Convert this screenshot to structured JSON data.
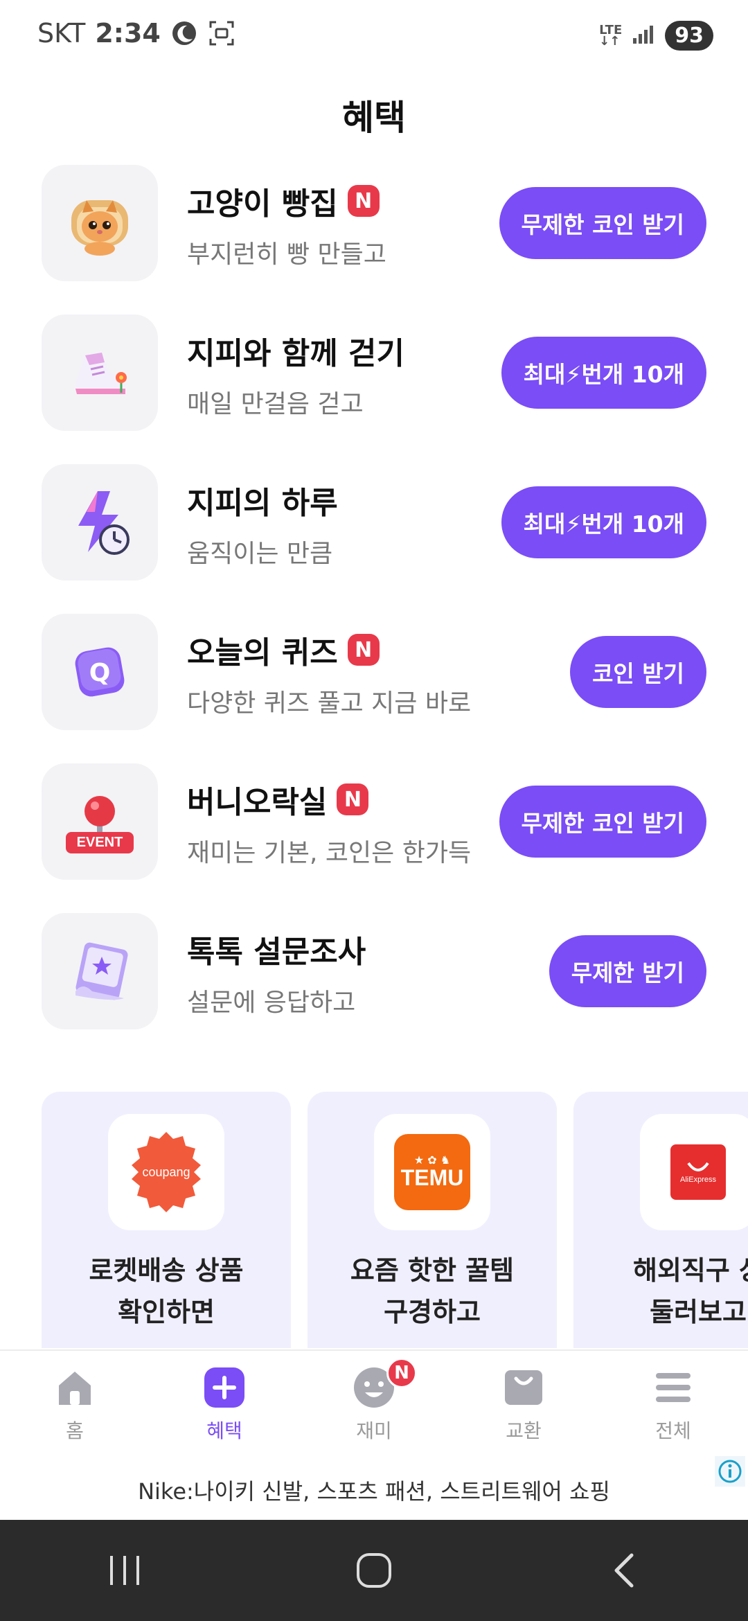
{
  "status_bar": {
    "carrier": "SKT",
    "time": "2:34",
    "network": "LTE",
    "battery": "93"
  },
  "page": {
    "title": "혜택"
  },
  "benefits": [
    {
      "title": "고양이 빵집",
      "subtitle": "부지런히 빵 만들고",
      "badge": "N",
      "button": "무제한 코인 받기",
      "icon": "cat-bread-icon"
    },
    {
      "title": "지피와 함께 걷기",
      "subtitle": "매일 만걸음 걷고",
      "badge": "",
      "button": "최대⚡번개 10개",
      "icon": "sneaker-icon"
    },
    {
      "title": "지피의 하루",
      "subtitle": "움직이는 만큼",
      "badge": "",
      "button": "최대⚡번개 10개",
      "icon": "lightning-clock-icon"
    },
    {
      "title": "오늘의 퀴즈",
      "subtitle": "다양한 퀴즈 풀고 지금 바로",
      "badge": "N",
      "button": "코인 받기",
      "icon": "quiz-icon"
    },
    {
      "title": "버니오락실",
      "subtitle": "재미는 기본, 코인은 한가득",
      "badge": "N",
      "button": "무제한 코인 받기",
      "icon": "joystick-event-icon",
      "icon_label": "EVENT"
    },
    {
      "title": "톡톡 설문조사",
      "subtitle": "설문에 응답하고",
      "badge": "",
      "button": "무제한 받기",
      "icon": "survey-icon"
    }
  ],
  "shop_cards": [
    {
      "logo_text": "coupang",
      "line1": "로켓배송 상품",
      "line2": "확인하면",
      "icon": "coupang-logo"
    },
    {
      "logo_text": "TEMU",
      "line1": "요즘 핫한 꿀템",
      "line2": "구경하고",
      "icon": "temu-logo"
    },
    {
      "logo_text": "AliExpress",
      "line1": "해외직구 상",
      "line2": "둘러보고",
      "icon": "aliexpress-logo"
    }
  ],
  "bottom_nav": [
    {
      "label": "홈",
      "icon": "home-icon"
    },
    {
      "label": "혜택",
      "icon": "plus-icon"
    },
    {
      "label": "재미",
      "icon": "smile-icon",
      "badge": "N"
    },
    {
      "label": "교환",
      "icon": "shopping-bag-icon"
    },
    {
      "label": "전체",
      "icon": "menu-icon"
    }
  ],
  "ad": {
    "text": "Nike:나이키 신발, 스포츠 패션, 스트리트웨어 쇼핑"
  },
  "colors": {
    "accent": "#7a4df6",
    "badge": "#e8394a",
    "card_bg": "#f0effd"
  }
}
